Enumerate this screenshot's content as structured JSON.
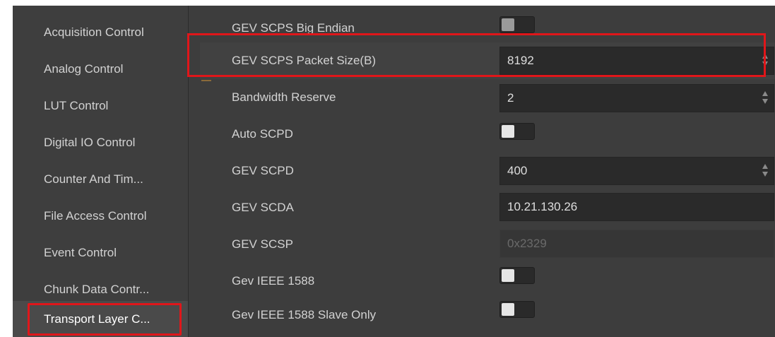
{
  "sidebar": {
    "items": [
      {
        "label": "Acquisition Control",
        "active": false
      },
      {
        "label": "Analog Control",
        "active": false
      },
      {
        "label": "LUT Control",
        "active": false
      },
      {
        "label": "Digital IO Control",
        "active": false
      },
      {
        "label": "Counter And Tim...",
        "active": false
      },
      {
        "label": "File Access Control",
        "active": false
      },
      {
        "label": "Event Control",
        "active": false
      },
      {
        "label": "Chunk Data Contr...",
        "active": false
      },
      {
        "label": "Transport Layer C...",
        "active": true
      }
    ]
  },
  "properties": [
    {
      "label": "GEV SCPS Big Endian",
      "type": "toggle",
      "on": false
    },
    {
      "label": "GEV SCPS Packet Size(B)",
      "type": "number",
      "value": "8192",
      "highlighted": true
    },
    {
      "label": "Bandwidth Reserve",
      "type": "number",
      "value": "2"
    },
    {
      "label": "Auto SCPD",
      "type": "toggle",
      "on": false
    },
    {
      "label": "GEV SCPD",
      "type": "number",
      "value": "400"
    },
    {
      "label": "GEV SCDA",
      "type": "text",
      "value": "10.21.130.26"
    },
    {
      "label": "GEV SCSP",
      "type": "text-disabled",
      "value": "0x2329"
    },
    {
      "label": "Gev IEEE 1588",
      "type": "toggle",
      "on": false
    },
    {
      "label": "Gev IEEE 1588 Slave Only",
      "type": "toggle",
      "on": false
    }
  ],
  "colors": {
    "highlight": "#e0161a",
    "panel_bg": "#3d3d3d",
    "field_bg": "#2a2a2a"
  }
}
